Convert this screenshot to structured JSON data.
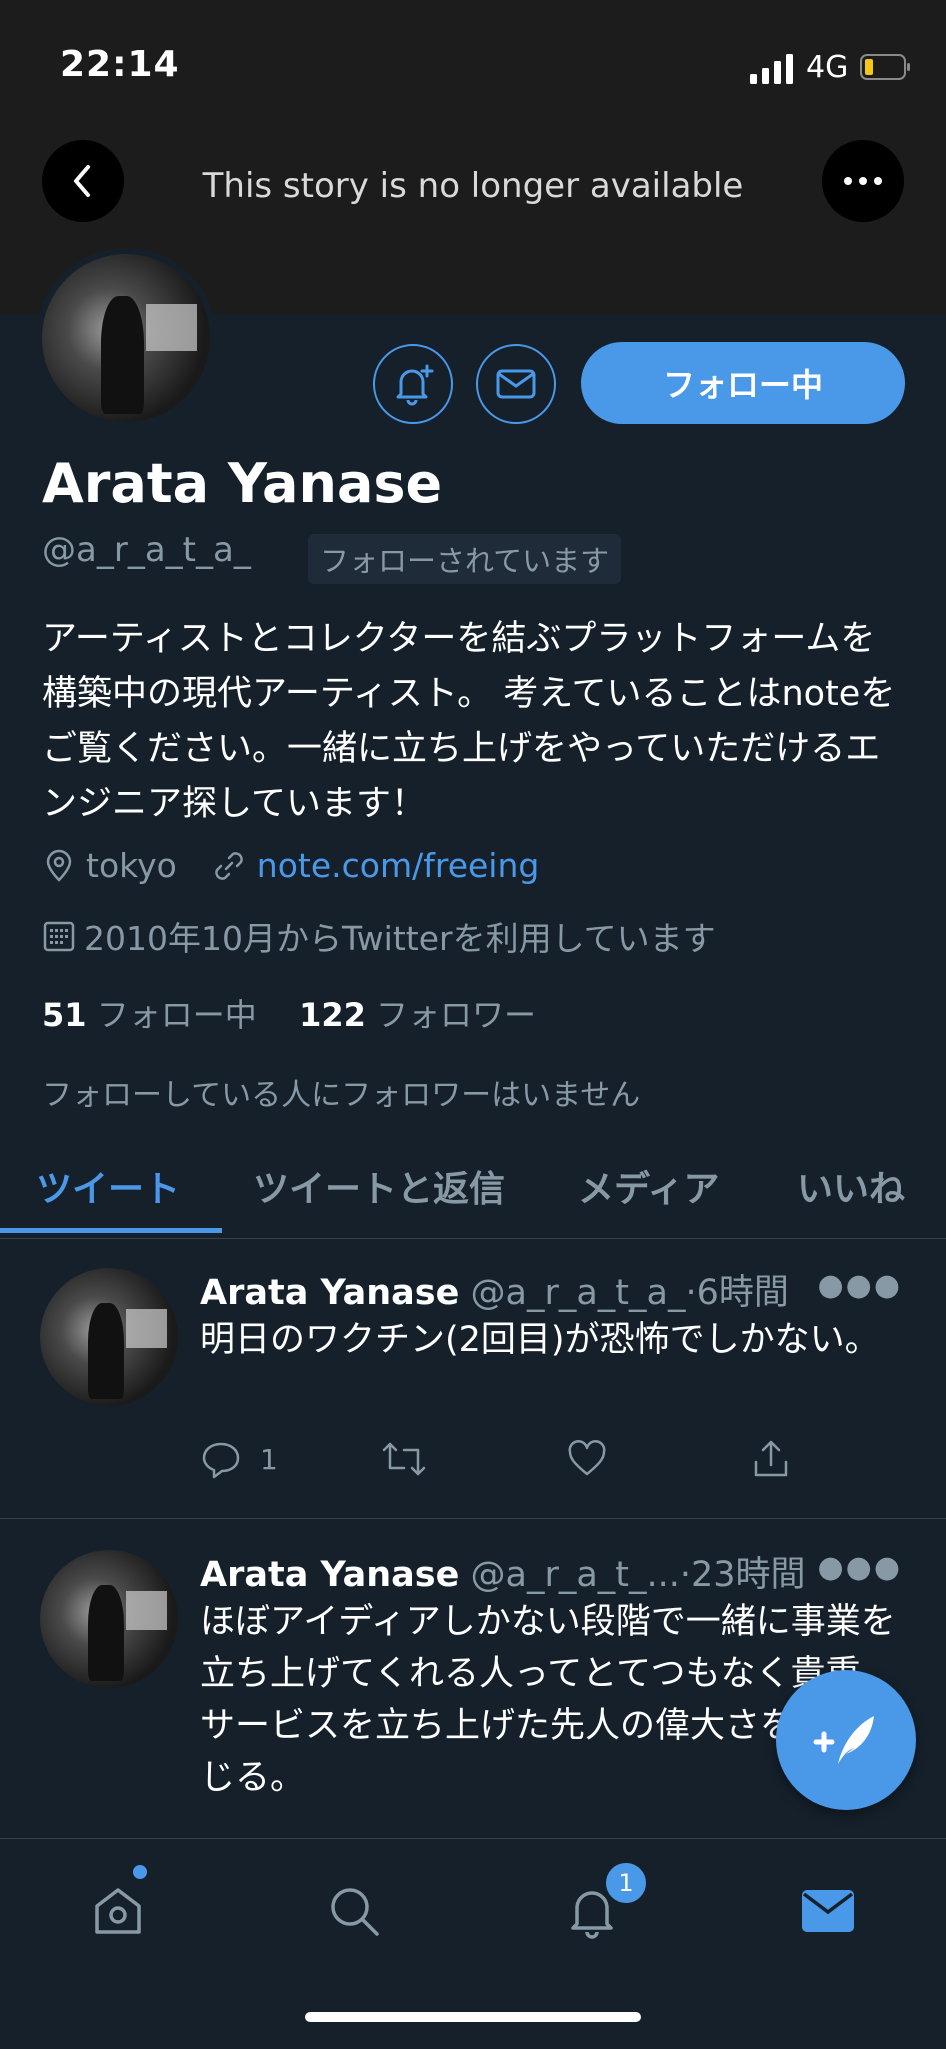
{
  "status_bar": {
    "time": "22:14",
    "network": "4G"
  },
  "header": {
    "story_message": "This story is no longer available"
  },
  "profile": {
    "follow_button": "フォロー中",
    "name": "Arata Yanase",
    "handle": "@a_r_a_t_a_",
    "follows_you": "フォローされています",
    "bio": "アーティストとコレクターを結ぶプラットフォームを構築中の現代アーティスト。 考えていることはnoteをご覧ください。一緒に立ち上げをやっていただけるエンジニア探しています！",
    "location": "tokyo",
    "url": "note.com/freeing",
    "joined": "2010年10月からTwitterを利用しています",
    "following_count": "51",
    "following_label": "フォロー中",
    "followers_count": "122",
    "followers_label": "フォロワー",
    "no_mutual_followers": "フォローしている人にフォロワーはいません"
  },
  "tabs": [
    {
      "label": "ツイート",
      "active": true
    },
    {
      "label": "ツイートと返信"
    },
    {
      "label": "メディア"
    },
    {
      "label": "いいね"
    }
  ],
  "tweets": [
    {
      "name": "Arata Yanase",
      "handle": "@a_r_a_t_a_",
      "time": "·6時間",
      "text": "明日のワクチン(2回目)が恐怖でしかない。",
      "replies": "1"
    },
    {
      "name": "Arata Yanase",
      "handle": "@a_r_a_t_...",
      "time": "·23時間",
      "text": "ほぼアイディアしかない段階で一緒に事業を立ち上げてくれる人ってとてつもなく貴重。サービスを立ち上げた先人の偉大さを日々感じる。"
    }
  ],
  "bottom_nav": {
    "notifications_badge": "1"
  },
  "colors": {
    "accent": "#4a99e9",
    "background": "#15202b",
    "secondary_text": "#8899a6"
  }
}
